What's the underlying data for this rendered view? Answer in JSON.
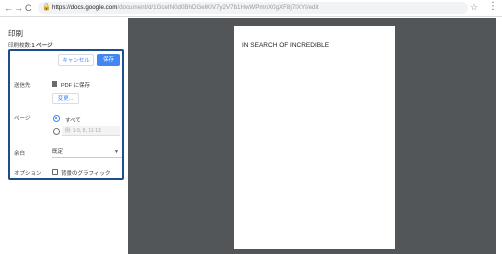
{
  "browser": {
    "back_glyph": "←",
    "forward_glyph": "→",
    "reload_glyph": "C",
    "home_glyph": "⌂",
    "lock_glyph": "🔒",
    "url_host": "https://docs.google.com",
    "url_path": "/document/d/1GceIN0d0BhDGelKIV7y2V7b1HwWPmnX0gXF8j7IXYI/edit",
    "star_glyph": "☆",
    "menu_glyph": "⋮"
  },
  "print_panel": {
    "title": "印刷",
    "page_count_label": "印刷枚数:",
    "page_count_value": "1 ページ",
    "cancel_label": "キャンセル",
    "save_label": "保存",
    "destination_label": "送信先",
    "destination_value": "PDF に保存",
    "change_label": "変更...",
    "pages_label": "ページ",
    "all_pages_label": "すべて",
    "range_placeholder": "例: 1-5, 8, 11-13",
    "margins_label": "余白",
    "margins_value": "既定",
    "options_label": "オプション",
    "bg_graphics_label": "背景のグラフィック",
    "pages_selected": "all",
    "bg_graphics_checked": false
  },
  "preview": {
    "page_text": "IN SEARCH OF INCREDIBLE"
  },
  "colors": {
    "accent": "#4285f4",
    "highlight_border": "#1e4d8b",
    "preview_bg": "#525659"
  }
}
